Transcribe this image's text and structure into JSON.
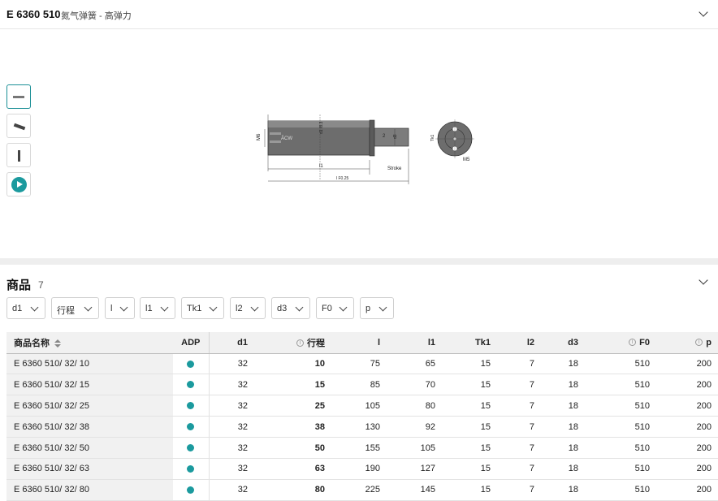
{
  "header": {
    "code": "E 6360 510",
    "subtitle": "氮气弹簧 - 高弹力"
  },
  "gallery": {
    "thumbnails": [
      "drawing-icon",
      "spring-side-icon",
      "spring-upright-icon",
      "play-video-icon"
    ],
    "drawing_labels": {
      "m6": "M6",
      "d1": "d1 f8.3",
      "two": "2",
      "d3": "d3",
      "tk1": "Tk1",
      "m5": "M5",
      "l1": "l1",
      "l": "l F0.25",
      "stroke": "Stroke",
      "finish_1": "superfinished",
      "finish_2": "nitrided",
      "marking": "ĀCW"
    }
  },
  "products": {
    "title": "商品",
    "count": "7",
    "filters": [
      "d1",
      "行程",
      "l",
      "l1",
      "Tk1",
      "l2",
      "d3",
      "F0",
      "p"
    ],
    "columns": [
      "商品名称",
      "ADP",
      "d1",
      "行程",
      "l",
      "l1",
      "Tk1",
      "l2",
      "d3",
      "F0",
      "p"
    ],
    "info_icon": "i",
    "rows": [
      {
        "name": "E 6360 510/ 32/ 10",
        "d1": "32",
        "stroke": "10",
        "l": "75",
        "l1": "65",
        "tk1": "15",
        "l2": "7",
        "d3": "18",
        "f0": "510",
        "p": "200"
      },
      {
        "name": "E 6360 510/ 32/ 15",
        "d1": "32",
        "stroke": "15",
        "l": "85",
        "l1": "70",
        "tk1": "15",
        "l2": "7",
        "d3": "18",
        "f0": "510",
        "p": "200"
      },
      {
        "name": "E 6360 510/ 32/ 25",
        "d1": "32",
        "stroke": "25",
        "l": "105",
        "l1": "80",
        "tk1": "15",
        "l2": "7",
        "d3": "18",
        "f0": "510",
        "p": "200"
      },
      {
        "name": "E 6360 510/ 32/ 38",
        "d1": "32",
        "stroke": "38",
        "l": "130",
        "l1": "92",
        "tk1": "15",
        "l2": "7",
        "d3": "18",
        "f0": "510",
        "p": "200"
      },
      {
        "name": "E 6360 510/ 32/ 50",
        "d1": "32",
        "stroke": "50",
        "l": "155",
        "l1": "105",
        "tk1": "15",
        "l2": "7",
        "d3": "18",
        "f0": "510",
        "p": "200"
      },
      {
        "name": "E 6360 510/ 32/ 63",
        "d1": "32",
        "stroke": "63",
        "l": "190",
        "l1": "127",
        "tk1": "15",
        "l2": "7",
        "d3": "18",
        "f0": "510",
        "p": "200"
      },
      {
        "name": "E 6360 510/ 32/ 80",
        "d1": "32",
        "stroke": "80",
        "l": "225",
        "l1": "145",
        "tk1": "15",
        "l2": "7",
        "d3": "18",
        "f0": "510",
        "p": "200"
      }
    ],
    "accent_color": "#1b9a9e"
  }
}
